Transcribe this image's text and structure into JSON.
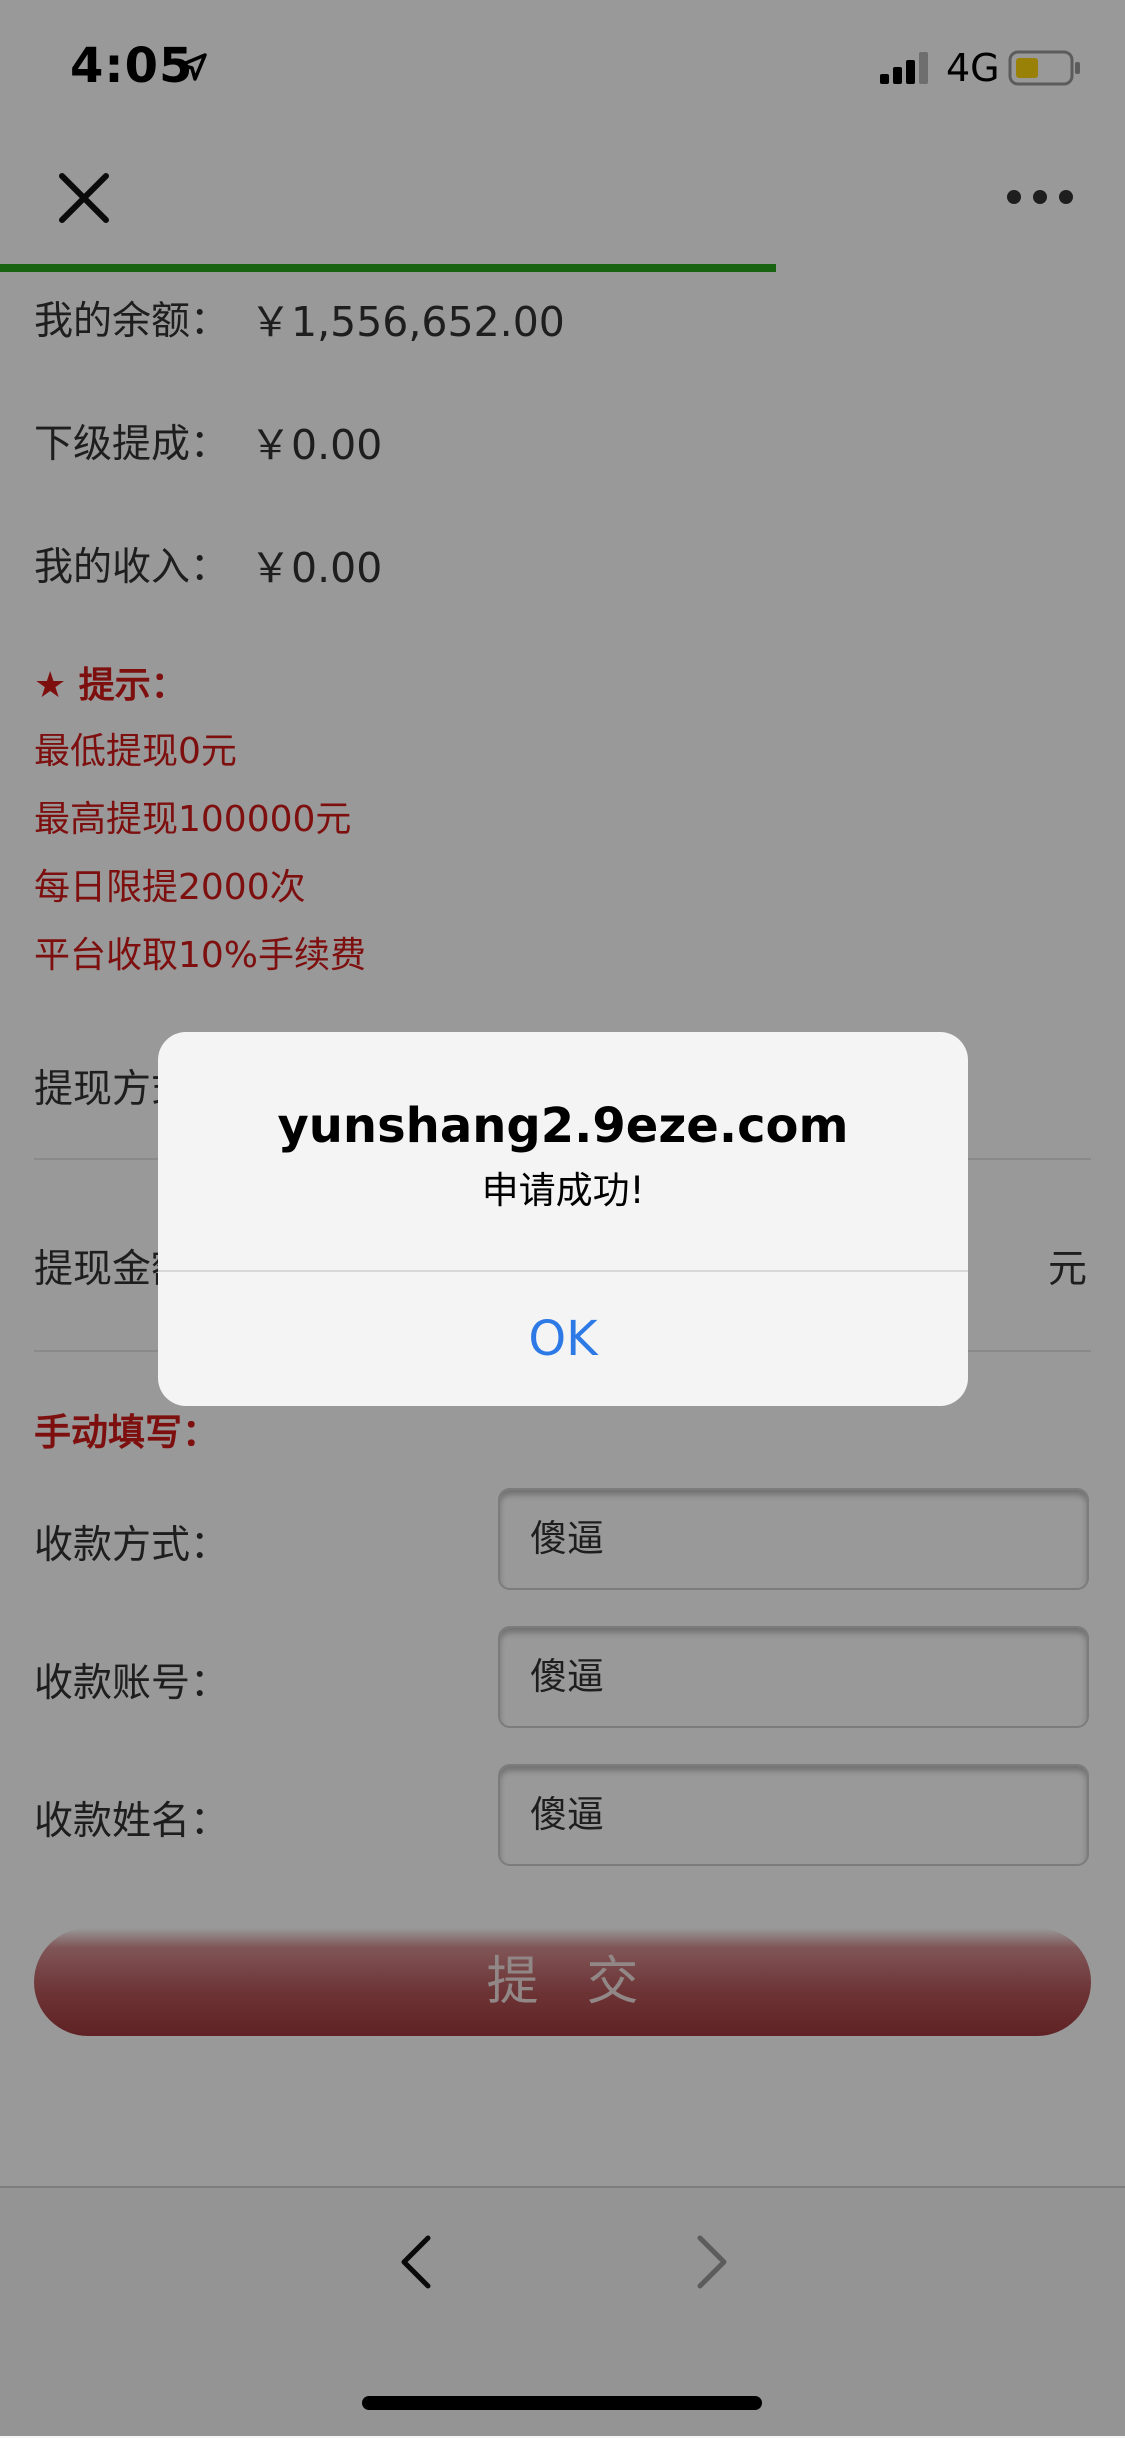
{
  "status_bar": {
    "time": "4:05",
    "network": "4G",
    "icons": [
      "location-arrow-icon",
      "signal-icon",
      "battery-icon"
    ]
  },
  "nav": {
    "close_icon": "close-icon",
    "more_icon": "more-icon",
    "load_progress": 0.69,
    "progress_color": "#28a61f"
  },
  "stats": [
    {
      "label": "我的余额：",
      "value": "￥1,556,652.00"
    },
    {
      "label": "下级提成：",
      "value": "￥0.00"
    },
    {
      "label": "我的收入：",
      "value": "￥0.00"
    }
  ],
  "tips": {
    "title": "★ 提示：",
    "lines": [
      "最低提现0元",
      "最高提现100000元",
      "每日限提2000次",
      "平台收取10%手续费"
    ]
  },
  "withdraw": {
    "method_label": "提现方式：",
    "amount_label": "提现金额：",
    "amount_unit": "元"
  },
  "manual": {
    "title": "手动填写：",
    "fields": [
      {
        "label": "收款方式：",
        "value": "傻逼"
      },
      {
        "label": "收款账号：",
        "value": "傻逼"
      },
      {
        "label": "收款姓名：",
        "value": "傻逼"
      }
    ]
  },
  "submit_label": "提交",
  "toolbar": {
    "back_icon": "back-arrow-icon",
    "forward_icon": "forward-arrow-icon"
  },
  "alert": {
    "title": "yunshang2.9eze.com",
    "message": "申请成功!",
    "ok_label": "OK"
  },
  "colors": {
    "accent_red": "#d21a1a",
    "link_blue": "#2d7ae6",
    "progress_green": "#28a61f"
  }
}
